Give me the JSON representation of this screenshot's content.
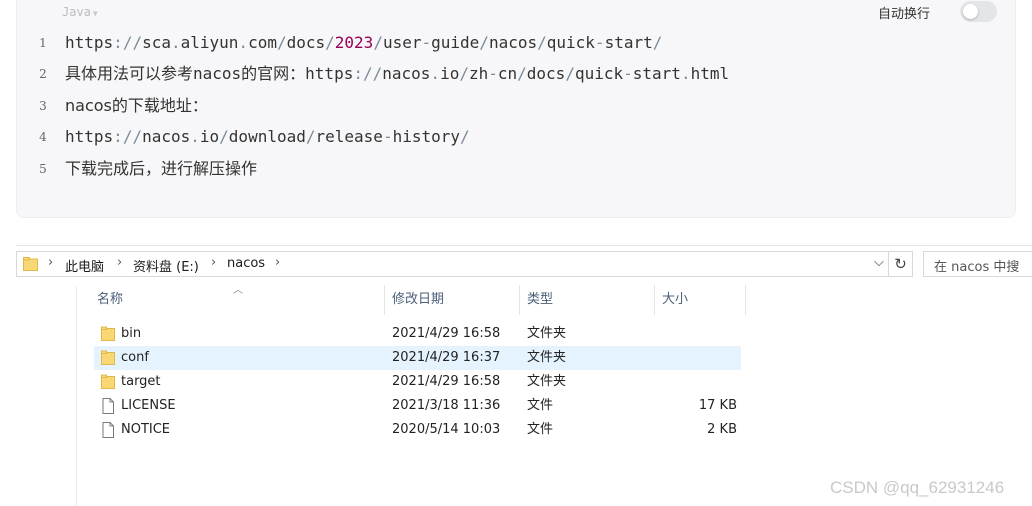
{
  "code_block": {
    "language_label": "Java",
    "wrap_label": "自动换行",
    "wrap_enabled": false,
    "lines": [
      {
        "number": "1",
        "segments": [
          {
            "t": "https",
            "c": ""
          },
          {
            "t": ":",
            "c": "p"
          },
          {
            "t": "//",
            "c": "p"
          },
          {
            "t": "sca",
            "c": ""
          },
          {
            "t": ".",
            "c": "p"
          },
          {
            "t": "aliyun",
            "c": ""
          },
          {
            "t": ".",
            "c": "p"
          },
          {
            "t": "com",
            "c": ""
          },
          {
            "t": "/",
            "c": "p"
          },
          {
            "t": "docs",
            "c": ""
          },
          {
            "t": "/",
            "c": "p"
          },
          {
            "t": "2023",
            "c": "n"
          },
          {
            "t": "/",
            "c": "p"
          },
          {
            "t": "user",
            "c": ""
          },
          {
            "t": "-",
            "c": "p"
          },
          {
            "t": "guide",
            "c": ""
          },
          {
            "t": "/",
            "c": "p"
          },
          {
            "t": "nacos",
            "c": ""
          },
          {
            "t": "/",
            "c": "p"
          },
          {
            "t": "quick",
            "c": ""
          },
          {
            "t": "-",
            "c": "p"
          },
          {
            "t": "start",
            "c": ""
          },
          {
            "t": "/",
            "c": "p"
          }
        ]
      },
      {
        "number": "2",
        "segments": [
          {
            "t": "具体用法可以参考nacos的官网：https",
            "c": ""
          },
          {
            "t": ":",
            "c": "p"
          },
          {
            "t": "//",
            "c": "p"
          },
          {
            "t": "nacos",
            "c": ""
          },
          {
            "t": ".",
            "c": "p"
          },
          {
            "t": "io",
            "c": ""
          },
          {
            "t": "/",
            "c": "p"
          },
          {
            "t": "zh",
            "c": ""
          },
          {
            "t": "-",
            "c": "p"
          },
          {
            "t": "cn",
            "c": ""
          },
          {
            "t": "/",
            "c": "p"
          },
          {
            "t": "docs",
            "c": ""
          },
          {
            "t": "/",
            "c": "p"
          },
          {
            "t": "quick",
            "c": ""
          },
          {
            "t": "-",
            "c": "p"
          },
          {
            "t": "start",
            "c": ""
          },
          {
            "t": ".",
            "c": "p"
          },
          {
            "t": "html",
            "c": ""
          }
        ]
      },
      {
        "number": "3",
        "segments": [
          {
            "t": "nacos的下载地址：",
            "c": ""
          }
        ]
      },
      {
        "number": "4",
        "segments": [
          {
            "t": "https",
            "c": ""
          },
          {
            "t": ":",
            "c": "p"
          },
          {
            "t": "//",
            "c": "p"
          },
          {
            "t": "nacos",
            "c": ""
          },
          {
            "t": ".",
            "c": "p"
          },
          {
            "t": "io",
            "c": ""
          },
          {
            "t": "/",
            "c": "p"
          },
          {
            "t": "download",
            "c": ""
          },
          {
            "t": "/",
            "c": "p"
          },
          {
            "t": "release",
            "c": ""
          },
          {
            "t": "-",
            "c": "p"
          },
          {
            "t": "history",
            "c": ""
          },
          {
            "t": "/",
            "c": "p"
          }
        ]
      },
      {
        "number": "5",
        "segments": [
          {
            "t": "下载完成后，进行解压操作",
            "c": ""
          }
        ]
      }
    ]
  },
  "explorer": {
    "breadcrumb": [
      "此电脑",
      "资料盘 (E:)",
      "nacos"
    ],
    "search_placeholder": "在 nacos 中搜",
    "columns": {
      "name": "名称",
      "modified": "修改日期",
      "type": "类型",
      "size": "大小"
    },
    "files": [
      {
        "name": "bin",
        "modified": "2021/4/29 16:58",
        "type": "文件夹",
        "size": "",
        "kind": "folder",
        "selected": false
      },
      {
        "name": "conf",
        "modified": "2021/4/29 16:37",
        "type": "文件夹",
        "size": "",
        "kind": "folder",
        "selected": true
      },
      {
        "name": "target",
        "modified": "2021/4/29 16:58",
        "type": "文件夹",
        "size": "",
        "kind": "folder",
        "selected": false
      },
      {
        "name": "LICENSE",
        "modified": "2021/3/18 11:36",
        "type": "文件",
        "size": "17 KB",
        "kind": "file",
        "selected": false
      },
      {
        "name": "NOTICE",
        "modified": "2020/5/14 10:03",
        "type": "文件",
        "size": "2 KB",
        "kind": "file",
        "selected": false
      }
    ]
  },
  "watermark": "CSDN @qq_62931246",
  "colors": {
    "code_bg": "#f7f7f9",
    "number_token": "#990055",
    "punctuation": "#7b8b99",
    "selection": "#e5f3ff",
    "folder": "#f8d775"
  }
}
